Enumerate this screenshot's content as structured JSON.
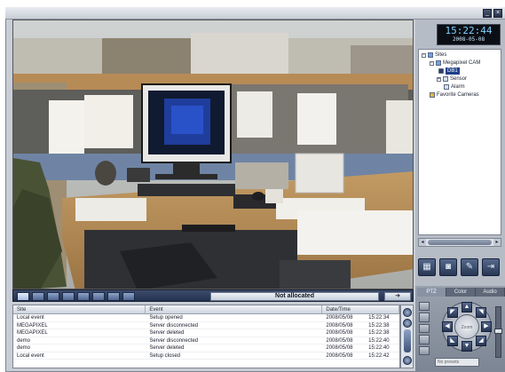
{
  "window": {
    "title": "",
    "buttons": [
      "minimize-button",
      "close-button"
    ]
  },
  "clock": {
    "time": "15:22:44",
    "date": "2008-05-08"
  },
  "tree": {
    "nodes": [
      {
        "label": "Sites",
        "icon": "site-icon"
      },
      {
        "label": "Megapixel CAM",
        "icon": "site-icon"
      },
      {
        "label": "DB1",
        "icon": "camera-icon",
        "selected": true
      },
      {
        "label": "Sensor",
        "icon": "sensor-icon"
      },
      {
        "label": "Alarm",
        "icon": "alarm-icon"
      },
      {
        "label": "Favorite Cameras",
        "icon": "star-icon"
      }
    ]
  },
  "toolbar": {
    "buttons": [
      "display-icon",
      "camera-icon",
      "wrench-icon",
      "exit-icon"
    ]
  },
  "layout_bar": {
    "status": "Not allocated",
    "go_icon": "arrow-right-icon"
  },
  "control_tabs": [
    "PTZ",
    "Color",
    "Audio"
  ],
  "ptz": {
    "center_label": "Zoom",
    "preset_placeholder": "No presets"
  },
  "log": {
    "columns": [
      "Site",
      "Event",
      "Date/Time"
    ],
    "rows": [
      {
        "site": "Local event",
        "event": "Setup opened",
        "date": "2008/05/08",
        "time": "15:22:34"
      },
      {
        "site": "MEGAPIXEL",
        "event": "Server disconnected",
        "date": "2008/05/08",
        "time": "15:22:38"
      },
      {
        "site": "MEGAPIXEL",
        "event": "Server deleted",
        "date": "2008/05/08",
        "time": "15:22:38"
      },
      {
        "site": "demo",
        "event": "Server disconnected",
        "date": "2008/05/08",
        "time": "15:22:40"
      },
      {
        "site": "demo",
        "event": "Server deleted",
        "date": "2008/05/08",
        "time": "15:22:40"
      },
      {
        "site": "Local event",
        "event": "Setup closed",
        "date": "2008/05/08",
        "time": "15:22:42"
      }
    ]
  },
  "colors": {
    "panel": "#b6bcc6",
    "clock_text": "#7fd0ff",
    "selection": "#1d3f8a"
  }
}
